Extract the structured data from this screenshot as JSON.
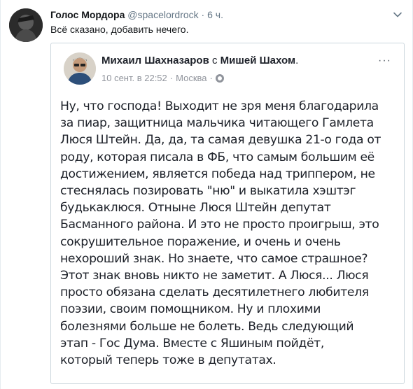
{
  "tweet": {
    "author_name": "Голос Мордора",
    "author_handle": "@spacelordrock",
    "separator": "·",
    "time": "6 ч.",
    "text": "Всё сказано, добавить нечего."
  },
  "embed": {
    "author": "Михаил Шахназаров",
    "with_word": "с",
    "with_name": "Мишей Шахом",
    "header_suffix": ".",
    "date": "10 сент. в 22:52",
    "separator": "·",
    "location": "Москва",
    "location_separator": "·",
    "menu_label": "···",
    "body": "Ну, что господа! Выходит не зря меня благодарила\nза пиар, защитница мальчика читающего Гамлета\nЛюся Штейн. Да, да, та самая девушка 21-о года от\nроду, которая писала в ФБ, что самым большим её\nдостижением, является победа над триппером, не\nстеснялась позировать \"ню\" и выкатила хэштэг\nбудькаклюся. Отныне Люся Штейн депутат\nБасманного района. И это не просто проигрыш, это\nсокрушительное поражение, и очень и очень\nнехороший знак. Но знаете, что самое страшное?\nЭтот знак вновь никто не заметит. А Люся... Люся\nпросто обязана сделать десятилетнего любителя\nпоэзии, своим помощником. Ну и плохими\nболезнями больше не болеть. Ведь следующий\nэтап - Гос Дума. Вместе с Яшиным пойдёт,\nкоторый теперь тоже в депутатах."
  },
  "icons": {
    "caret": "chevron-down-icon",
    "globe": "globe-icon"
  },
  "colors": {
    "secondary_text": "#657786",
    "border": "#ccd6dd",
    "fb_meta": "#90949c"
  }
}
